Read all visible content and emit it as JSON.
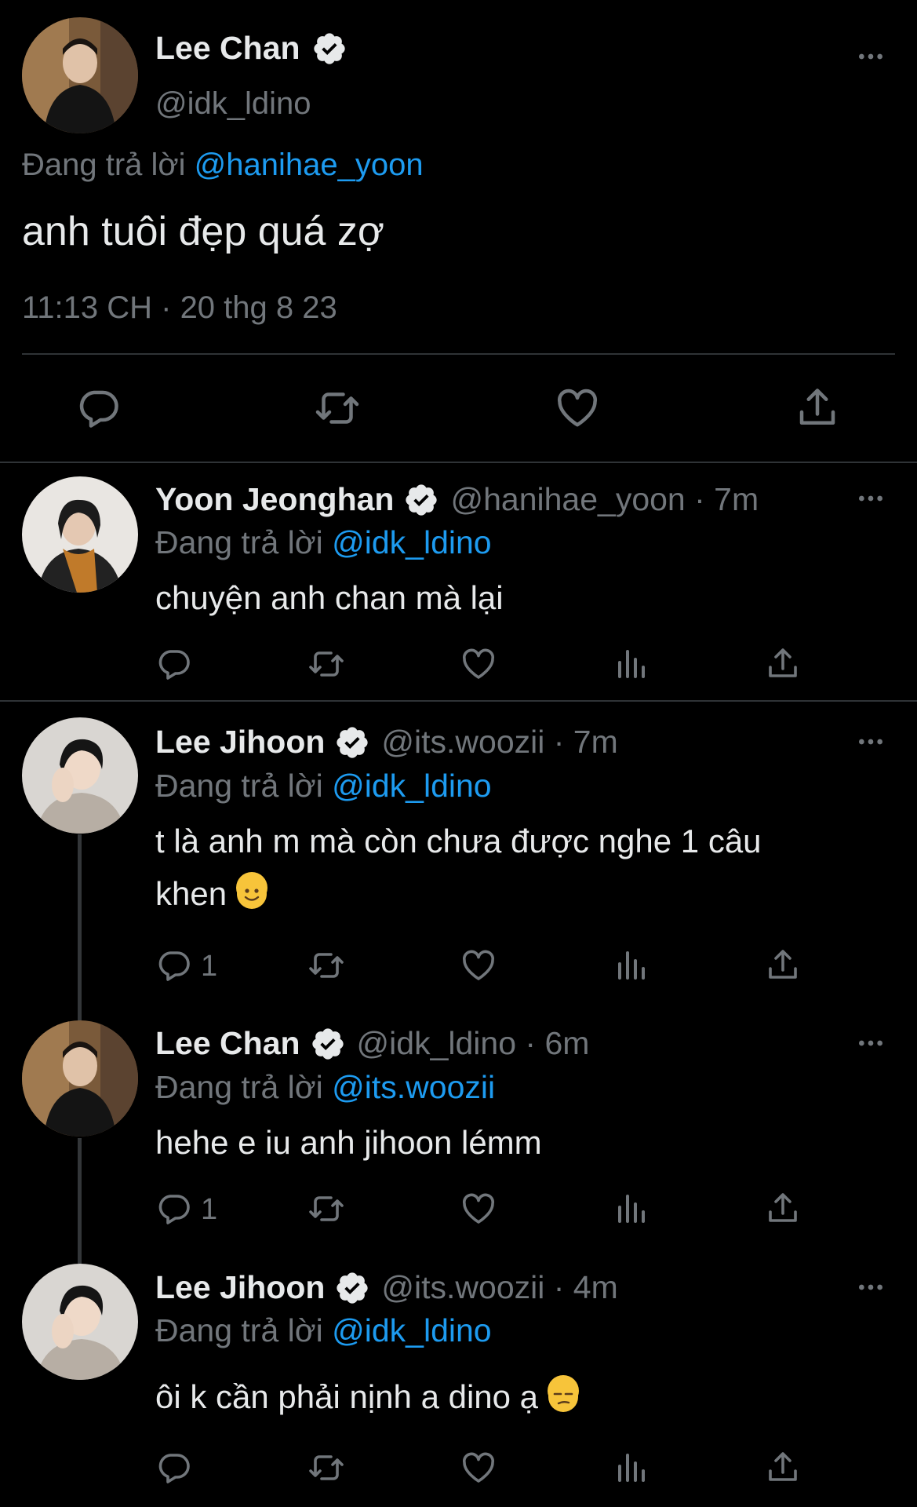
{
  "main_tweet": {
    "name": "Lee Chan",
    "handle": "@idk_ldino",
    "replying_prefix": "Đang trả lời ",
    "replying_to": "@hanihae_yoon",
    "text": "anh tuôi đẹp quá zợ",
    "timestamp": "11:13 CH · 20 thg 8 23"
  },
  "replies": [
    {
      "name": "Yoon Jeonghan",
      "handle_time": "@hanihae_yoon · 7m",
      "replying_prefix": "Đang trả lời ",
      "replying_to": "@idk_ldino",
      "text": "chuyện anh chan mà lại",
      "reply_count": ""
    },
    {
      "name": "Lee Jihoon",
      "handle_time": "@its.woozii · 7m",
      "replying_prefix": "Đang trả lời ",
      "replying_to": "@idk_ldino",
      "text": "t là anh m mà còn chưa được nghe 1 câu khen",
      "reply_count": "1"
    },
    {
      "name": "Lee Chan",
      "handle_time": "@idk_ldino · 6m",
      "replying_prefix": "Đang trả lời ",
      "replying_to": "@its.woozii",
      "text": "hehe e iu anh jihoon lémm",
      "reply_count": "1"
    },
    {
      "name": "Lee Jihoon",
      "handle_time": "@its.woozii · 4m",
      "replying_prefix": "Đang trả lời ",
      "replying_to": "@idk_ldino",
      "text": "ôi k cần phải nịnh a dino ạ",
      "reply_count": ""
    }
  ],
  "colors": {
    "background": "#000000",
    "text": "#e7e9ea",
    "secondary": "#71767b",
    "accent": "#1d9bf0",
    "divider": "#2f3336"
  },
  "icons": [
    "verified-badge-icon",
    "more-icon",
    "reply-icon",
    "retweet-icon",
    "like-icon",
    "views-icon",
    "share-icon",
    "smile-emoji-icon",
    "unamused-emoji-icon"
  ]
}
